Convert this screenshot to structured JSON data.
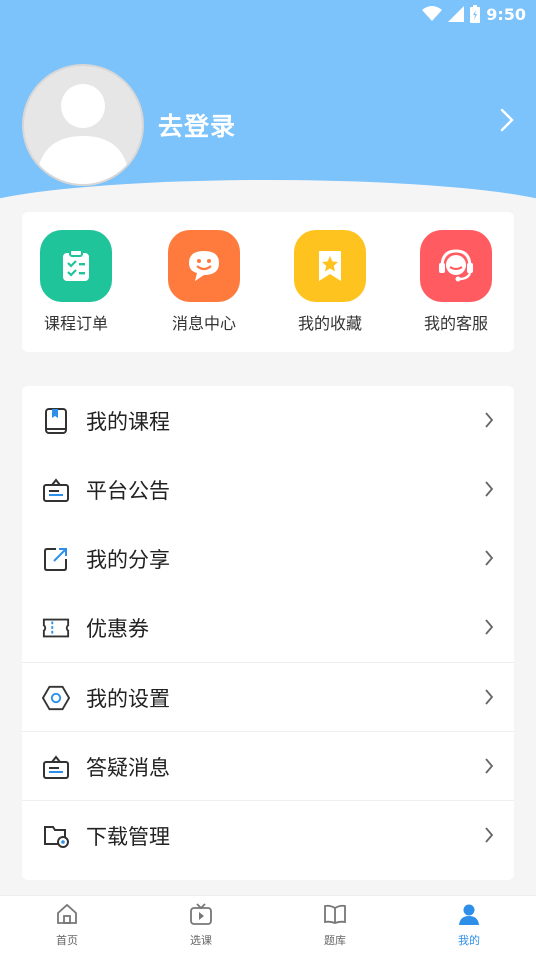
{
  "status": {
    "time": "9:50"
  },
  "profile": {
    "login_text": "去登录"
  },
  "quick_actions": [
    {
      "label": "课程订单",
      "icon": "clipboard-check-icon",
      "color": "#1fc49a"
    },
    {
      "label": "消息中心",
      "icon": "chat-face-icon",
      "color": "#ff7a3d"
    },
    {
      "label": "我的收藏",
      "icon": "star-bookmark-icon",
      "color": "#ffc31f"
    },
    {
      "label": "我的客服",
      "icon": "headset-icon",
      "color": "#ff5b61"
    }
  ],
  "menu": [
    {
      "label": "我的课程",
      "icon": "book-icon"
    },
    {
      "label": "平台公告",
      "icon": "announcement-icon"
    },
    {
      "label": "我的分享",
      "icon": "share-icon"
    },
    {
      "label": "优惠券",
      "icon": "coupon-icon"
    },
    {
      "label": "我的设置",
      "icon": "settings-icon"
    },
    {
      "label": "答疑消息",
      "icon": "message-icon"
    },
    {
      "label": "下载管理",
      "icon": "download-folder-icon"
    }
  ],
  "tabbar": [
    {
      "label": "首页",
      "icon": "home-icon",
      "active": false
    },
    {
      "label": "选课",
      "icon": "tv-play-icon",
      "active": false
    },
    {
      "label": "题库",
      "icon": "open-book-icon",
      "active": false
    },
    {
      "label": "我的",
      "icon": "user-icon",
      "active": true
    }
  ],
  "colors": {
    "header": "#7cc2fb",
    "accent": "#2e8fe8"
  }
}
